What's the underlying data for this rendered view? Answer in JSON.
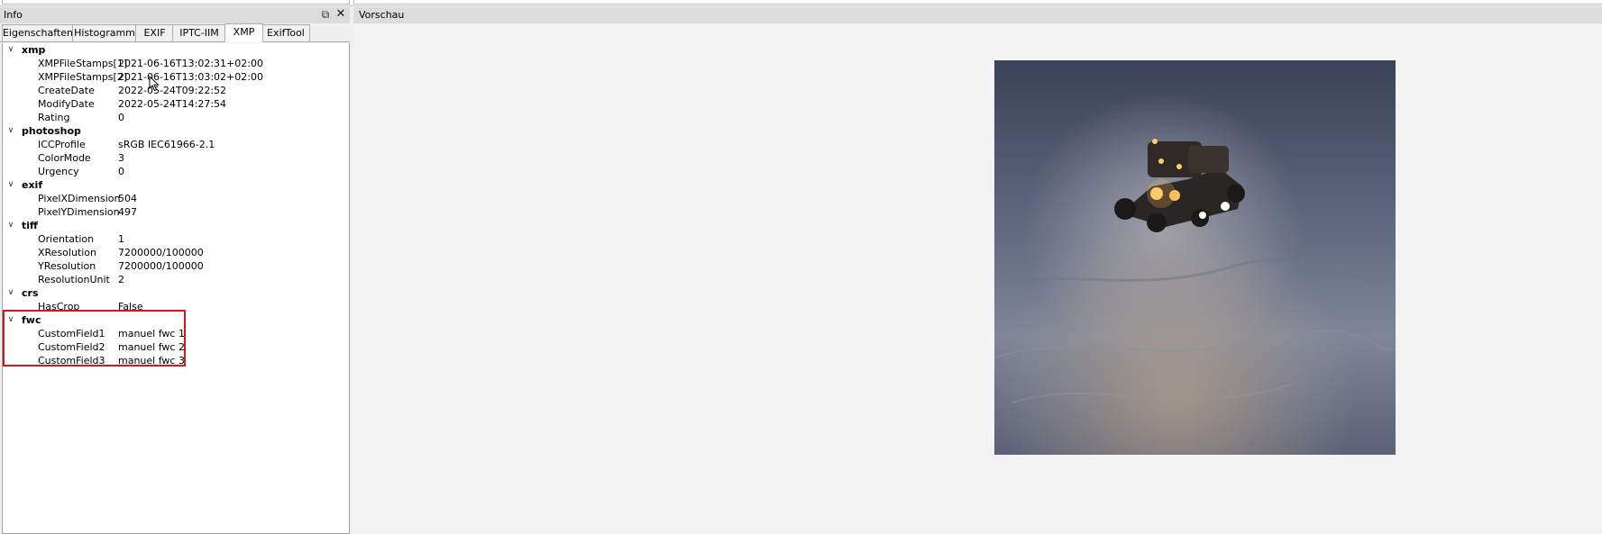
{
  "left_panel": {
    "title": "Info",
    "tabs": [
      "Eigenschaften",
      "Histogramm",
      "EXIF",
      "IPTC-IIM",
      "XMP",
      "ExifTool"
    ],
    "active_tab": "XMP",
    "groups": [
      {
        "name": "xmp",
        "props": [
          {
            "key": "XMPFileStamps[1]",
            "value": "2021-06-16T13:02:31+02:00"
          },
          {
            "key": "XMPFileStamps[2]",
            "value": "2021-06-16T13:03:02+02:00"
          },
          {
            "key": "CreateDate",
            "value": "2022-05-24T09:22:52"
          },
          {
            "key": "ModifyDate",
            "value": "2022-05-24T14:27:54"
          },
          {
            "key": "Rating",
            "value": "0"
          }
        ]
      },
      {
        "name": "photoshop",
        "props": [
          {
            "key": "ICCProfile",
            "value": "sRGB IEC61966-2.1"
          },
          {
            "key": "ColorMode",
            "value": "3"
          },
          {
            "key": "Urgency",
            "value": "0"
          }
        ]
      },
      {
        "name": "exif",
        "props": [
          {
            "key": "PixelXDimension",
            "value": "504"
          },
          {
            "key": "PixelYDimension",
            "value": "497"
          }
        ]
      },
      {
        "name": "tiff",
        "props": [
          {
            "key": "Orientation",
            "value": "1"
          },
          {
            "key": "XResolution",
            "value": "7200000/100000"
          },
          {
            "key": "YResolution",
            "value": "7200000/100000"
          },
          {
            "key": "ResolutionUnit",
            "value": "2"
          }
        ]
      },
      {
        "name": "crs",
        "props": [
          {
            "key": "HasCrop",
            "value": "False"
          }
        ]
      },
      {
        "name": "fwc",
        "props": [
          {
            "key": "CustomField1",
            "value": "manuel fwc 1"
          },
          {
            "key": "CustomField2",
            "value": "manuel fwc 2"
          },
          {
            "key": "CustomField3",
            "value": "manuel fwc 3"
          }
        ]
      }
    ]
  },
  "right_panel": {
    "title": "Vorschau"
  },
  "icons": {
    "float": "float-window-icon",
    "close": "close-icon",
    "expand": "chevron-down-icon"
  },
  "colors": {
    "highlight": "#cc1a1a",
    "titlebar": "#dcdcdc"
  }
}
